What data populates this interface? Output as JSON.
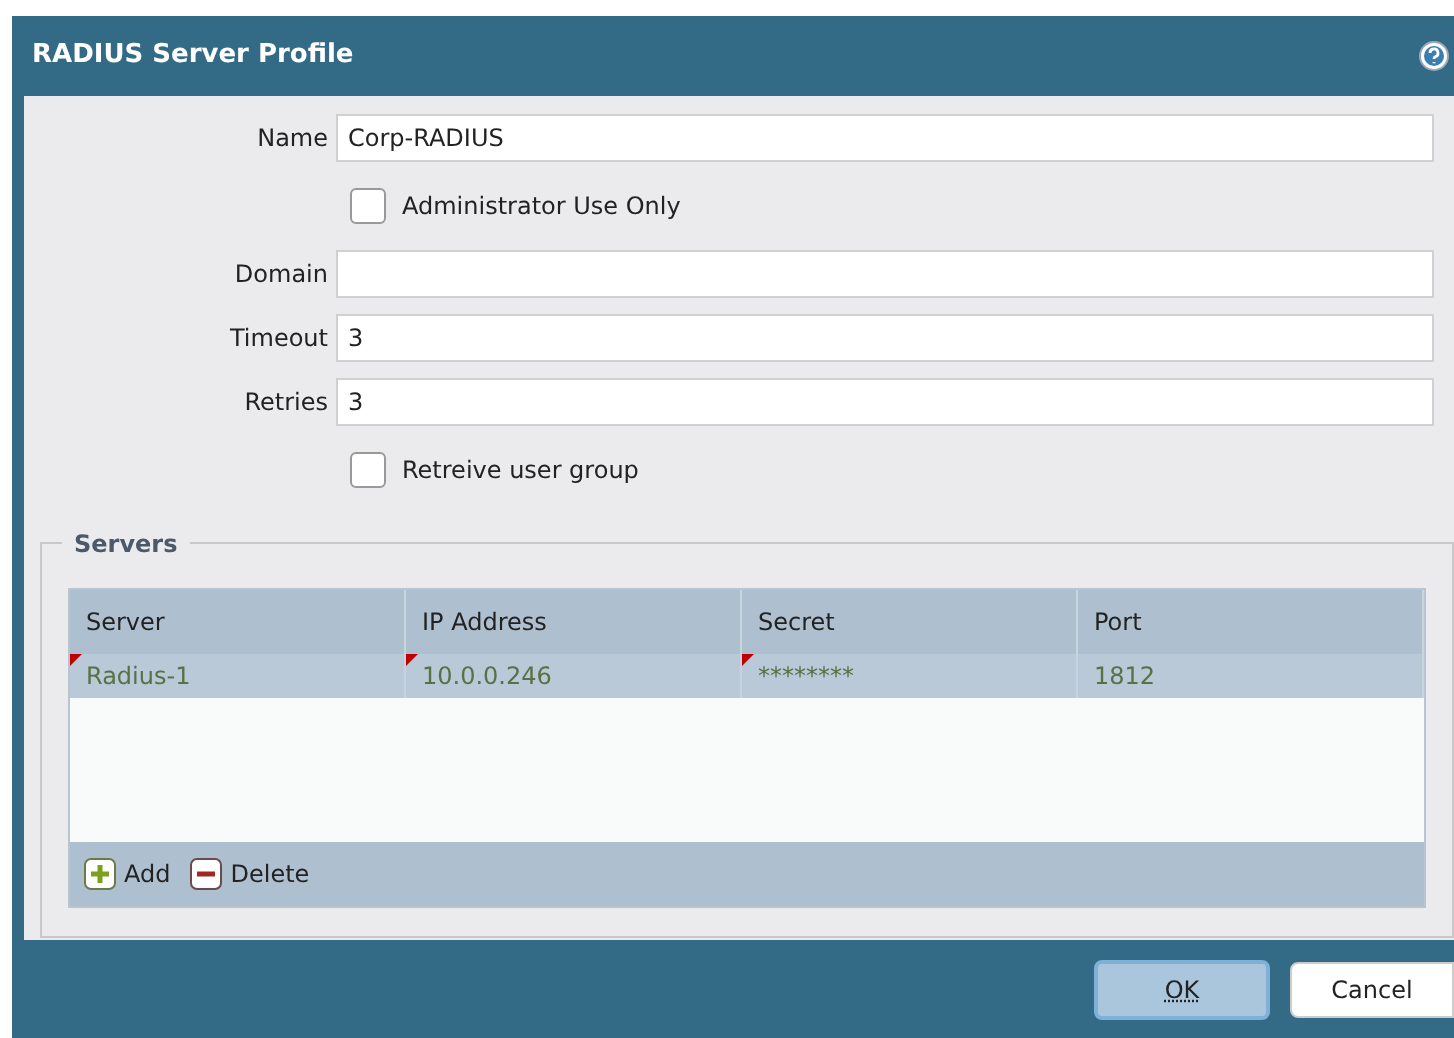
{
  "window": {
    "title": "RADIUS Server Profile"
  },
  "fields": [
    {
      "kind": "text",
      "label": "Name",
      "value": "Corp-RADIUS"
    },
    {
      "kind": "checkbox",
      "label": "Administrator Use Only",
      "checked": false
    },
    {
      "kind": "text",
      "label": "Domain"
    },
    {
      "kind": "text",
      "label": "Timeout",
      "value": "3"
    },
    {
      "kind": "text",
      "label": "Retries",
      "value": "3"
    },
    {
      "kind": "checkbox",
      "label": "Retreive user group",
      "checked": false
    }
  ],
  "servers": {
    "legend": "Servers",
    "columns": [
      "Server",
      "IP Address",
      "Secret",
      "Port"
    ],
    "rows": [
      {
        "cells": [
          "Radius-1",
          "10.0.0.246",
          "********",
          "1812"
        ],
        "modified": [
          true,
          true,
          true,
          false
        ],
        "selected": true
      }
    ],
    "actions": [
      {
        "kind": "add",
        "label": "Add"
      },
      {
        "kind": "delete",
        "label": "Delete"
      }
    ]
  },
  "buttons": [
    {
      "label": "OK",
      "default": true
    },
    {
      "label": "Cancel",
      "default": false
    }
  ]
}
